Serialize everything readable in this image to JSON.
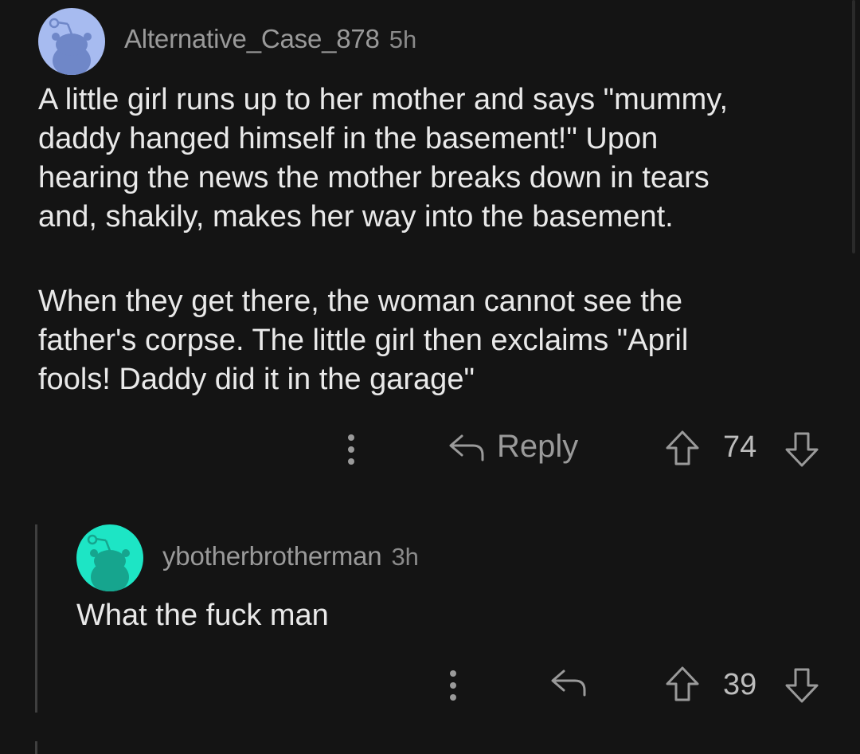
{
  "colors": {
    "background": "#141414",
    "avatar_1": "#a7bbf0",
    "avatar_2": "#1de5c5",
    "text_primary": "#e9e9e9",
    "text_meta": "#9a9a9a"
  },
  "comments": [
    {
      "username": "Alternative_Case_878",
      "age": "5h",
      "avatar_icon": "reddit-snoo-icon",
      "paragraphs": [
        "A little girl runs up to her mother and says \"mummy,\ndaddy hanged himself in the basement!\" Upon\nhearing the news the mother breaks down in tears\nand, shakily, makes her way into the basement.",
        "When they get there, the woman cannot see the\nfather's corpse. The little girl then exclaims \"April\nfools! Daddy did it in the garage\""
      ],
      "reply_label": "Reply",
      "score": "74"
    },
    {
      "username": "ybotherbrotherman",
      "age": "3h",
      "avatar_icon": "reddit-snoo-icon",
      "paragraphs": [
        "What the fuck man"
      ],
      "score": "39"
    }
  ]
}
